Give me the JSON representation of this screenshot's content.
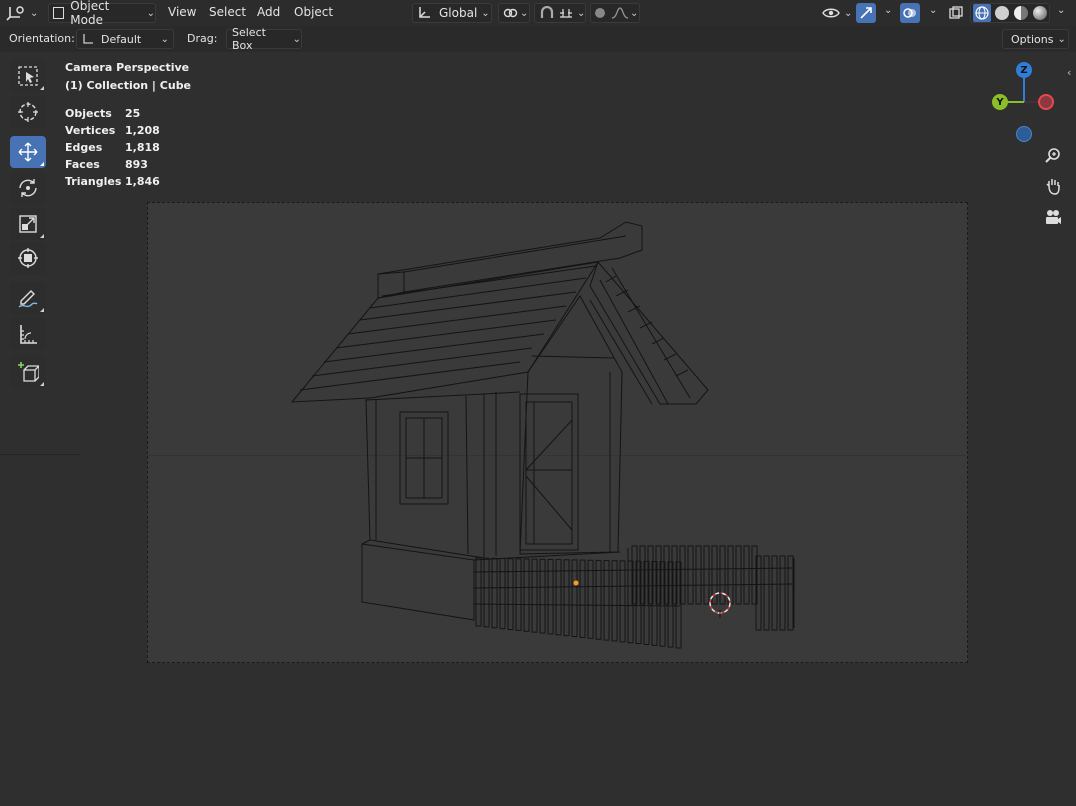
{
  "header": {
    "editor_type_icon": "3d-viewport-icon",
    "mode_label": "Object Mode",
    "menus": [
      "View",
      "Select",
      "Add",
      "Object"
    ],
    "transform_orientation": "Global",
    "shading_modes": [
      "wireframe",
      "solid",
      "material",
      "rendered"
    ],
    "active_shading": "wireframe"
  },
  "subheader": {
    "orientation_label": "Orientation:",
    "orientation_value": "Default",
    "drag_label": "Drag:",
    "drag_value": "Select Box",
    "options_label": "Options"
  },
  "toolbar": {
    "tools": [
      {
        "name": "select-box-tool",
        "icon": "select-box-icon",
        "active": false
      },
      {
        "name": "cursor-tool",
        "icon": "cursor-icon",
        "active": false
      },
      {
        "name": "move-tool",
        "icon": "move-icon",
        "active": true
      },
      {
        "name": "rotate-tool",
        "icon": "rotate-icon",
        "active": false
      },
      {
        "name": "scale-tool",
        "icon": "scale-icon",
        "active": false
      },
      {
        "name": "transform-tool",
        "icon": "transform-icon",
        "active": false
      },
      {
        "name": "annotate-tool",
        "icon": "annotate-icon",
        "active": false
      },
      {
        "name": "measure-tool",
        "icon": "measure-icon",
        "active": false
      },
      {
        "name": "add-cube-tool",
        "icon": "add-cube-icon",
        "active": false
      }
    ]
  },
  "viewport_info": {
    "view_name": "Camera Perspective",
    "collection": "(1) Collection | Cube"
  },
  "stats": [
    {
      "label": "Objects",
      "value": "25"
    },
    {
      "label": "Vertices",
      "value": "1,208"
    },
    {
      "label": "Edges",
      "value": "1,818"
    },
    {
      "label": "Faces",
      "value": "893"
    },
    {
      "label": "Triangles",
      "value": "1,846"
    }
  ],
  "gizmo": {
    "z_label": "Z",
    "y_label": "Y",
    "colors": {
      "x": "#e8484e",
      "y": "#8bbf2a",
      "z": "#2f7fd8"
    }
  },
  "colors": {
    "accent": "#4772b3",
    "viewport_bg": "#393939",
    "header_bg": "#2c2c2c"
  }
}
